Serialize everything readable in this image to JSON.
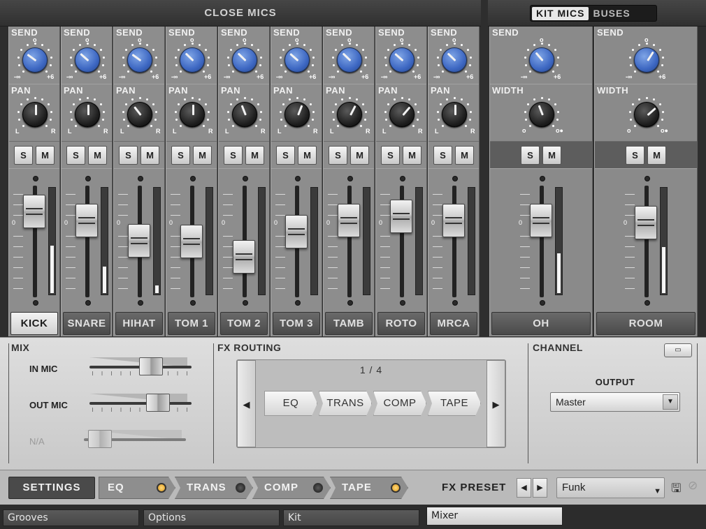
{
  "close_mics": {
    "title": "CLOSE MICS",
    "channels": [
      {
        "name": "KICK",
        "selected": true,
        "send": 0.3,
        "pan": 0.5,
        "fader": 0.9,
        "meter": 0.45
      },
      {
        "name": "SNARE",
        "send": 0.32,
        "pan": 0.5,
        "fader": 0.8,
        "meter": 0.25
      },
      {
        "name": "HIHAT",
        "send": 0.3,
        "pan": 0.36,
        "fader": 0.58,
        "meter": 0.07
      },
      {
        "name": "TOM 1",
        "send": 0.33,
        "pan": 0.5,
        "fader": 0.57,
        "meter": 0.0
      },
      {
        "name": "TOM 2",
        "send": 0.33,
        "pan": 0.42,
        "fader": 0.4,
        "meter": 0.0
      },
      {
        "name": "TOM 3",
        "send": 0.32,
        "pan": 0.58,
        "fader": 0.68,
        "meter": 0.0
      },
      {
        "name": "TAMB",
        "send": 0.33,
        "pan": 0.6,
        "fader": 0.8,
        "meter": 0.0
      },
      {
        "name": "ROTO",
        "send": 0.32,
        "pan": 0.65,
        "fader": 0.85,
        "meter": 0.0
      },
      {
        "name": "MRCA",
        "send": 0.33,
        "pan": 0.5,
        "fader": 0.8,
        "meter": 0.0
      }
    ]
  },
  "buses": {
    "tabs": [
      "KIT MICS",
      "BUSES"
    ],
    "active_tab": "KIT MICS",
    "channels": [
      {
        "name": "OH",
        "send": 0.35,
        "width": 0.42,
        "fader": 0.8,
        "meter": 0.38
      },
      {
        "name": "ROOM",
        "send": 0.62,
        "width": 0.68,
        "fader": 0.78,
        "meter": 0.44
      }
    ]
  },
  "labels": {
    "send": "SEND",
    "pan": "PAN",
    "width": "WIDTH",
    "solo": "S",
    "mute": "M",
    "minus_inf": "-∞",
    "plus6": "+6",
    "zero": "0",
    "L": "L",
    "R": "R",
    "o": "o"
  },
  "mix": {
    "title": "MIX",
    "in_mic": {
      "label": "IN MIC",
      "value": 0.63
    },
    "out_mic": {
      "label": "OUT MIC",
      "value": 0.72
    },
    "na": {
      "label": "N/A",
      "value": 0.05
    }
  },
  "fx_routing": {
    "title": "FX ROUTING",
    "page": "1 / 4",
    "prev": "◀",
    "next": "▶",
    "chain": [
      "EQ",
      "TRANS",
      "COMP",
      "TAPE"
    ]
  },
  "channel": {
    "title": "CHANNEL",
    "output_label": "OUTPUT",
    "output_value": "Master",
    "dropdown": "▼",
    "icon": "channel-config-icon",
    "icon_glyph": "▭"
  },
  "fx_bar": {
    "settings_label": "SETTINGS",
    "tabs": [
      {
        "label": "EQ",
        "on": true
      },
      {
        "label": "TRANS",
        "on": false
      },
      {
        "label": "COMP",
        "on": false
      },
      {
        "label": "TAPE",
        "on": true
      }
    ],
    "preset_label": "FX PRESET",
    "prev": "◀",
    "next": "▶",
    "preset_value": "Funk",
    "dropdown": "▼",
    "save_glyph": "🖫",
    "delete_glyph": "⊘"
  },
  "page_tabs": [
    {
      "label": "Grooves"
    },
    {
      "label": "Options"
    },
    {
      "label": "Kit"
    },
    {
      "label": "Mixer",
      "active": true
    }
  ],
  "colors": {
    "knob_blue": "#3d67c2",
    "knob_black": "#1d1d1d",
    "led_on": "#e09a1c"
  }
}
